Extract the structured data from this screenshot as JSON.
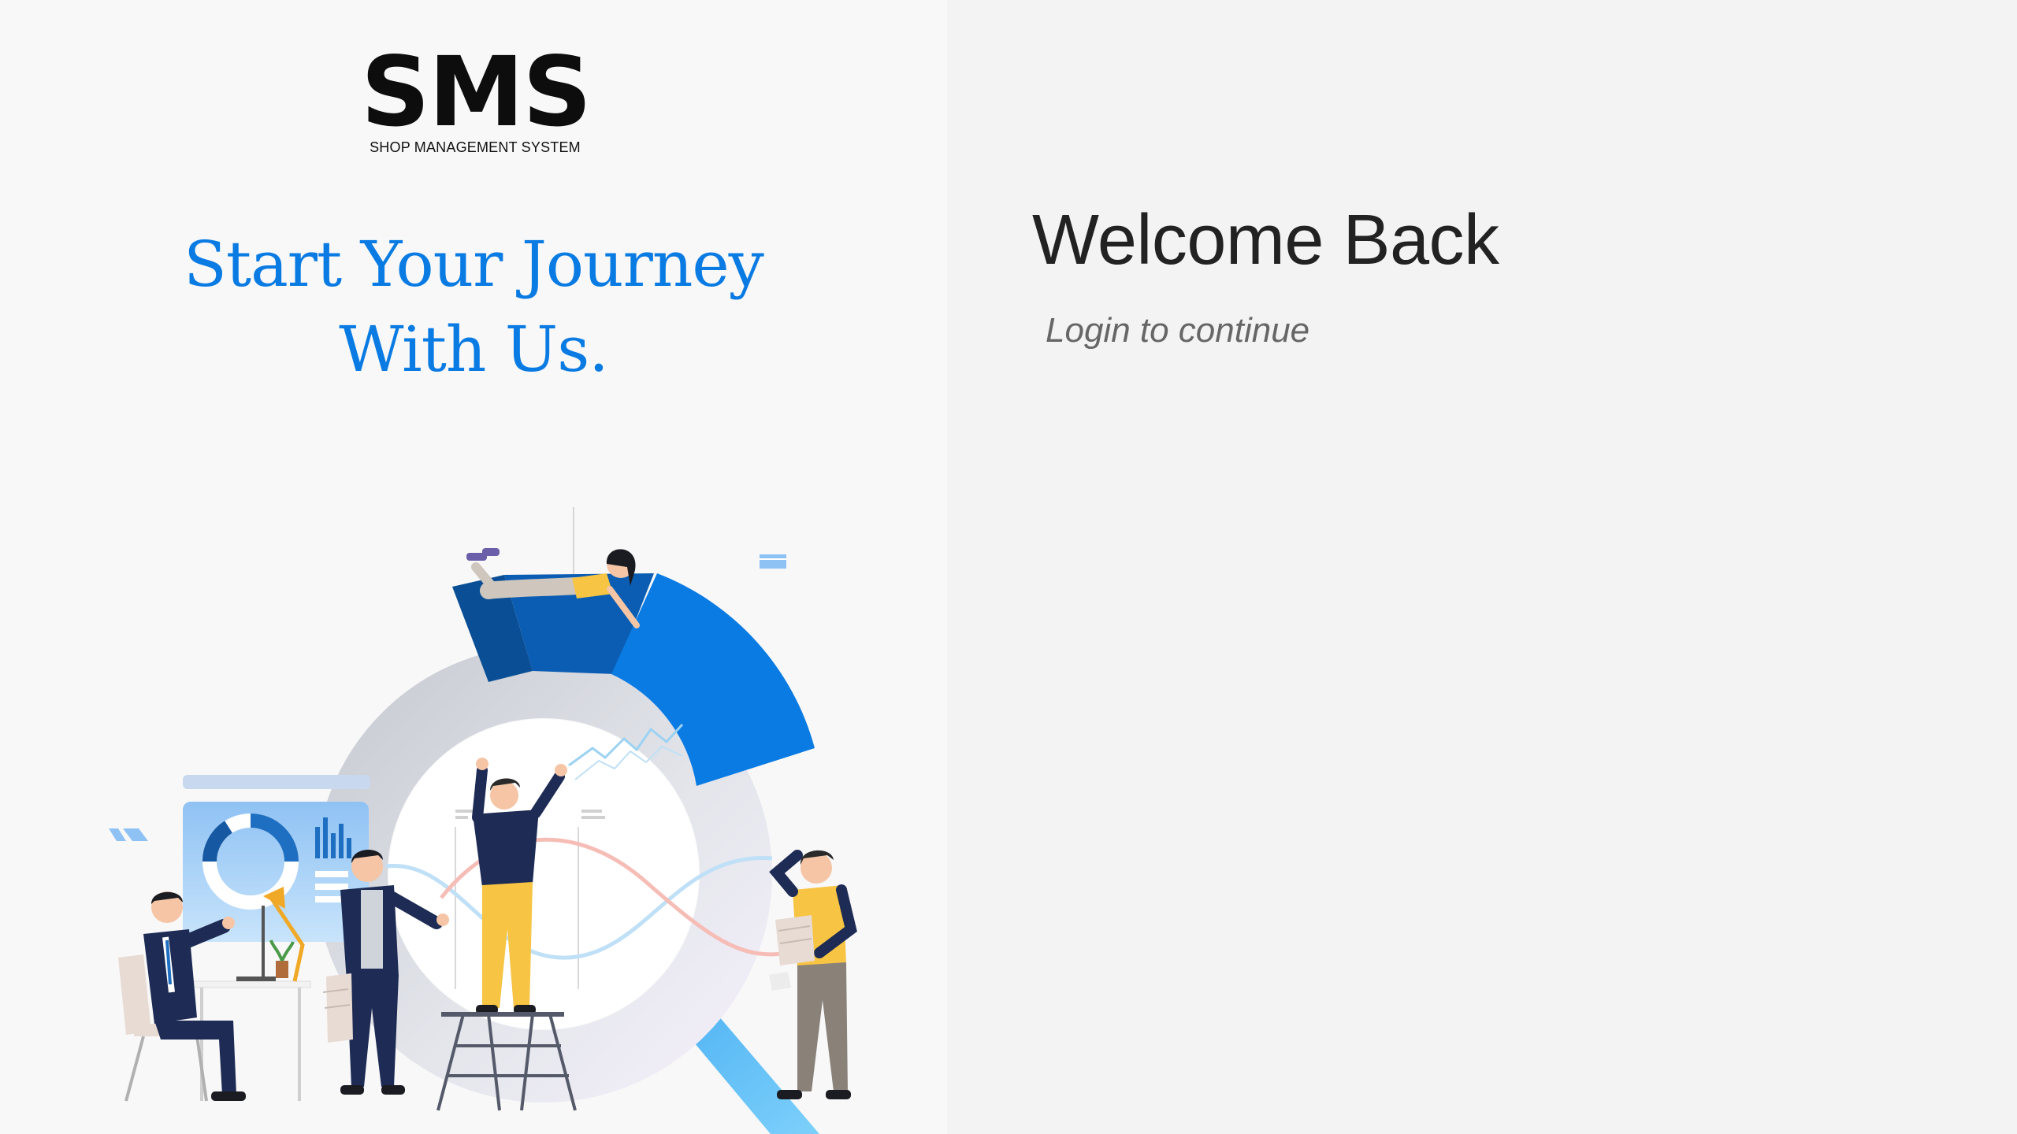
{
  "brand": {
    "logo_title": "SMS",
    "logo_subtitle": "SHOP MANAGEMENT SYSTEM"
  },
  "left_panel": {
    "tagline_line1": "Start Your Journey",
    "tagline_line2": "With Us.",
    "illustration": "business-team-analytics-illustration"
  },
  "right_panel": {
    "title": "Welcome Back",
    "subtitle": "Login to continue"
  },
  "colors": {
    "accent": "#0a7be3",
    "left_bg": "#f8f8f8",
    "right_bg": "#f3f3f3",
    "heading": "#222222",
    "subtext": "#666666"
  }
}
